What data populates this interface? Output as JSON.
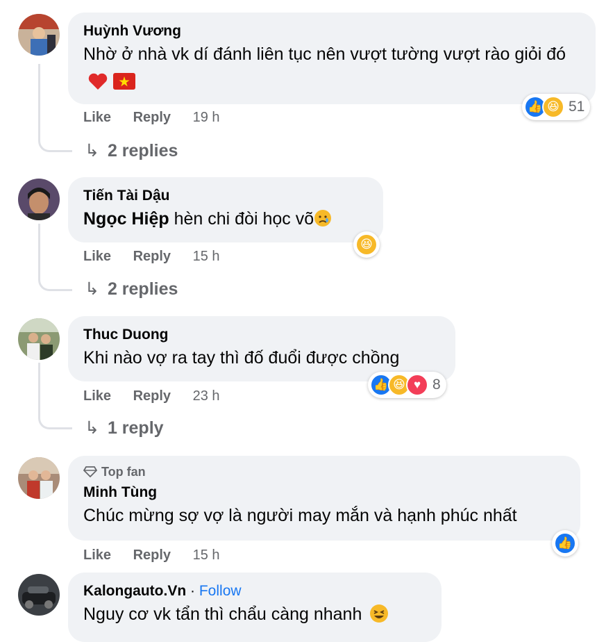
{
  "comments": [
    {
      "author": "Huỳnh Vương",
      "text": "Nhờ ở nhà vk dí đánh liên tục nên vượt tường vượt rào giỏi đó",
      "like": "Like",
      "reply": "Reply",
      "time": "19 h",
      "reaction_count": "51",
      "replies": "2 replies"
    },
    {
      "author": "Tiến Tài Dậu",
      "mention": "Ngọc Hiệp",
      "text": "hèn chi đòi học võ",
      "like": "Like",
      "reply": "Reply",
      "time": "15 h",
      "replies": "2 replies"
    },
    {
      "author": "Thuc Duong",
      "text": "Khi nào vợ ra tay thì đố đuổi được chồng",
      "like": "Like",
      "reply": "Reply",
      "time": "23 h",
      "reaction_count": "8",
      "replies": "1 reply"
    },
    {
      "badge": "Top fan",
      "author": "Minh Tùng",
      "text": "Chúc mừng sợ vợ là người may mắn và hạnh phúc nhất",
      "like": "Like",
      "reply": "Reply",
      "time": "15 h"
    },
    {
      "author": "Kalongauto.Vn",
      "follow": "Follow",
      "separator": "·",
      "text": "Nguy cơ vk tẩn thì chẩu càng nhanh"
    }
  ],
  "colors": {
    "bubble": "#f0f2f5",
    "like_blue": "#1877f2",
    "haha_yellow": "#f7b928",
    "love_red": "#f33e58",
    "meta_gray": "#65676b"
  },
  "icons": [
    "like-icon",
    "haha-icon",
    "love-icon",
    "heart-emoji",
    "vietnam-flag-emoji",
    "sad-emoji",
    "laugh-emoji",
    "reply-arrow-icon",
    "diamond-icon"
  ]
}
